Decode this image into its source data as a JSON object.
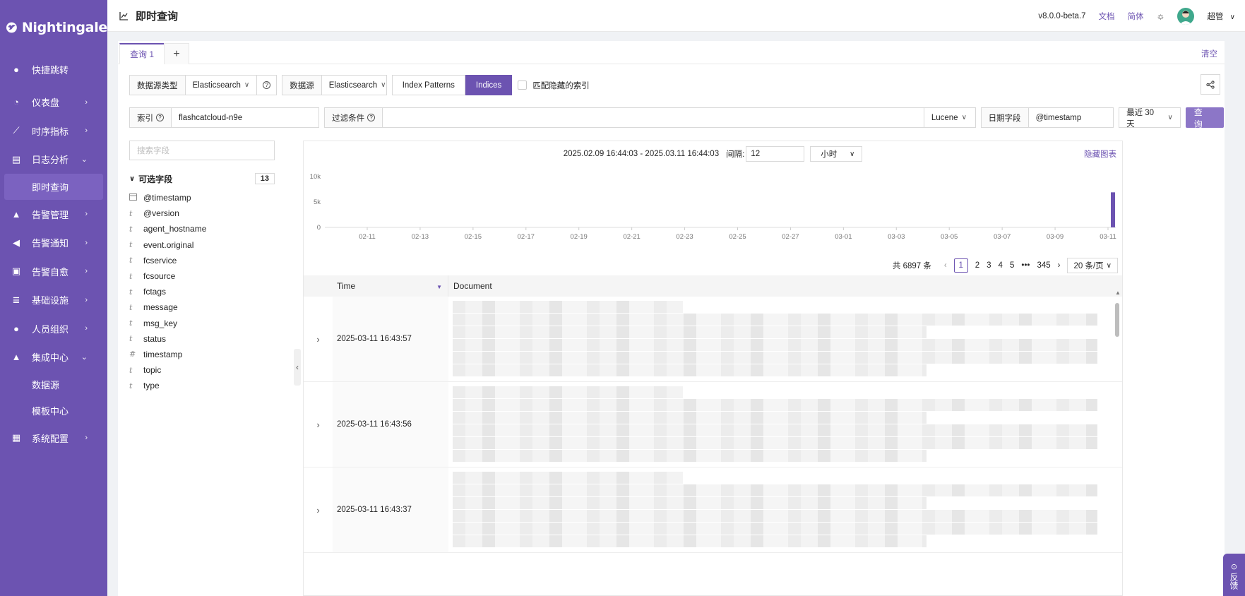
{
  "app": {
    "logo_text": "Nightingale",
    "accent": "#6C53B1"
  },
  "sidebar": {
    "items": [
      {
        "label": "快捷跳转",
        "icon": "search-icon"
      },
      {
        "label": "仪表盘",
        "icon": "dashboard-icon",
        "arrow": "›"
      },
      {
        "label": "时序指标",
        "icon": "line-chart-icon",
        "arrow": "›"
      },
      {
        "label": "日志分析",
        "icon": "log-icon",
        "arrow": "⌄"
      },
      {
        "label": "即时查询",
        "sub": true,
        "active": true
      },
      {
        "label": "告警管理",
        "icon": "alarm-icon",
        "arrow": "›"
      },
      {
        "label": "告警通知",
        "icon": "notify-icon",
        "arrow": "›"
      },
      {
        "label": "告警自愈",
        "icon": "terminal-icon",
        "arrow": "›"
      },
      {
        "label": "基础设施",
        "icon": "server-icon",
        "arrow": "›"
      },
      {
        "label": "人员组织",
        "icon": "user-icon",
        "arrow": "›"
      },
      {
        "label": "集成中心",
        "icon": "integration-icon",
        "arrow": "⌄"
      },
      {
        "label": "数据源",
        "sub": true
      },
      {
        "label": "模板中心",
        "sub": true
      },
      {
        "label": "系统配置",
        "icon": "settings-grid-icon",
        "arrow": "›"
      }
    ]
  },
  "header": {
    "title": "即时查询",
    "version": "v8.0.0-beta.7",
    "docs": "文档",
    "lang": "简体",
    "user": "超管"
  },
  "tabs": {
    "active": "查询 1",
    "add": "+",
    "clear": "清空"
  },
  "query": {
    "ds_type_label": "数据源类型",
    "ds_type_value": "Elasticsearch",
    "ds_label": "数据源",
    "ds_value": "Elasticsearch",
    "seg_index_patterns": "Index Patterns",
    "seg_indices": "Indices",
    "match_hidden": "匹配隐藏的索引",
    "index_label": "索引",
    "index_value": "flashcatcloud-n9e",
    "filter_label": "过滤条件",
    "syntax": "Lucene",
    "date_field_label": "日期字段",
    "date_field_value": "@timestamp",
    "range": "最近 30 天",
    "submit": "查 询"
  },
  "fields": {
    "search_placeholder": "搜索字段",
    "section": "可选字段",
    "count": "13",
    "list": [
      {
        "type": "date",
        "name": "@timestamp"
      },
      {
        "type": "t",
        "name": "@version"
      },
      {
        "type": "t",
        "name": "agent_hostname"
      },
      {
        "type": "t",
        "name": "event.original"
      },
      {
        "type": "t",
        "name": "fcservice"
      },
      {
        "type": "t",
        "name": "fcsource"
      },
      {
        "type": "t",
        "name": "fctags"
      },
      {
        "type": "t",
        "name": "message"
      },
      {
        "type": "t",
        "name": "msg_key"
      },
      {
        "type": "t",
        "name": "status"
      },
      {
        "type": "#",
        "name": "timestamp"
      },
      {
        "type": "t",
        "name": "topic"
      },
      {
        "type": "t",
        "name": "type"
      }
    ]
  },
  "result": {
    "time_range": "2025.02.09 16:44:03 - 2025.03.11 16:44:03",
    "interval_label": "间隔:",
    "interval_value": "12",
    "interval_unit": "小时",
    "hide_chart": "隐藏图表",
    "total": "共 6897 条",
    "pages": [
      "1",
      "2",
      "3",
      "4",
      "5",
      "•••",
      "345"
    ],
    "page_size": "20 条/页",
    "col_time": "Time",
    "col_document": "Document",
    "rows": [
      {
        "time": "2025-03-11 16:43:57"
      },
      {
        "time": "2025-03-11 16:43:56"
      },
      {
        "time": "2025-03-11 16:43:37"
      }
    ]
  },
  "chart_data": {
    "type": "bar",
    "y_ticks": [
      "10k",
      "5k",
      "0"
    ],
    "ylim": [
      0,
      10000
    ],
    "x_ticks": [
      "02-11",
      "02-13",
      "02-15",
      "02-17",
      "02-19",
      "02-21",
      "02-23",
      "02-25",
      "02-27",
      "03-01",
      "03-03",
      "03-05",
      "03-07",
      "03-09",
      "03-11"
    ],
    "bars": [
      {
        "x": "03-11",
        "value": 6897
      }
    ],
    "bar_color": "#6C53B1"
  },
  "feedback": "反馈"
}
